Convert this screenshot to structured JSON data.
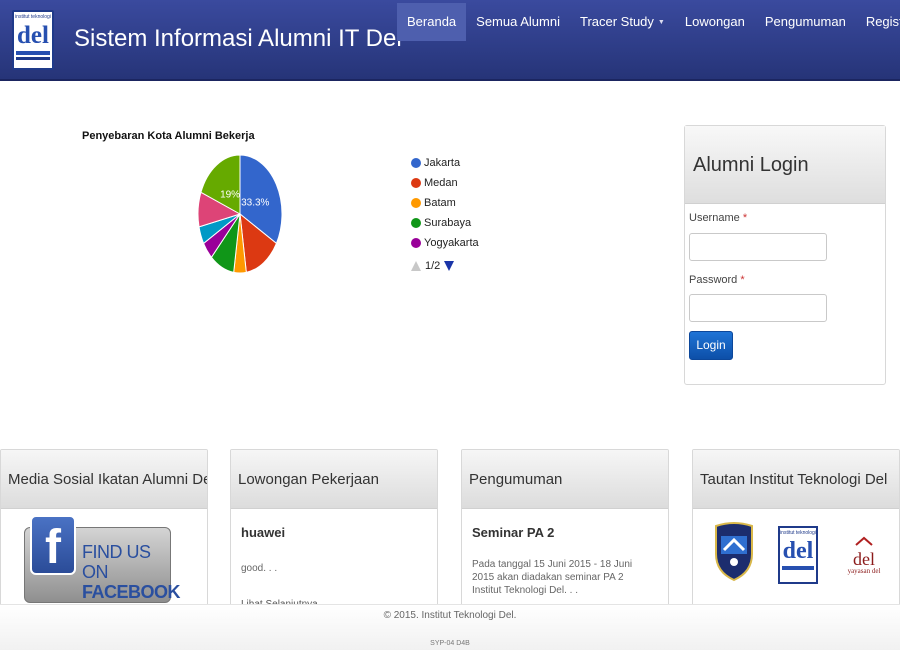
{
  "header": {
    "logo_caption": "institut teknologi",
    "logo_word": "del",
    "title": "Sistem Informasi Alumni IT Del",
    "nav": [
      {
        "label": "Beranda",
        "active": true
      },
      {
        "label": "Semua Alumni"
      },
      {
        "label": "Tracer Study",
        "dropdown": true
      },
      {
        "label": "Lowongan"
      },
      {
        "label": "Pengumuman"
      },
      {
        "label": "Registrasi"
      }
    ]
  },
  "chart_data": {
    "type": "pie",
    "title": "Penyebaran Kota Alumni Bekerja",
    "slices": [
      {
        "label": "Jakarta",
        "value": 33.3,
        "color": "#3366cc",
        "shown_label": "33.3%"
      },
      {
        "label": "Medan",
        "value": 14.3,
        "color": "#dc3912"
      },
      {
        "label": "Batam",
        "value": 4.8,
        "color": "#ff9900"
      },
      {
        "label": "Surabaya",
        "value": 9.5,
        "color": "#109618"
      },
      {
        "label": "Yogyakarta",
        "value": 4.8,
        "color": "#990099"
      },
      {
        "label": "",
        "value": 4.8,
        "color": "#0099c6"
      },
      {
        "label": "",
        "value": 9.5,
        "color": "#dd4477"
      },
      {
        "label": "",
        "value": 19.0,
        "color": "#66aa00",
        "shown_label": "19%"
      }
    ],
    "legend_visible": [
      "Jakarta",
      "Medan",
      "Batam",
      "Surabaya",
      "Yogyakarta"
    ],
    "legend_page": "1/2",
    "legend_position": "right"
  },
  "login": {
    "heading": "Alumni Login",
    "username_label": "Username",
    "password_label": "Password",
    "required_mark": "*",
    "button": "Login"
  },
  "panels": {
    "social": {
      "title": "Media Sosial Ikatan Alumni Del",
      "fb_line1": "FIND US ON",
      "fb_line2": "FACEBOOK",
      "fb_glyph": "f"
    },
    "jobs": {
      "title": "Lowongan Pekerjaan",
      "item_title": "huawei",
      "item_text": "good. . .",
      "more": "Lihat Selanjutnya"
    },
    "news": {
      "title": "Pengumuman",
      "item_title": "Seminar PA 2",
      "item_text": "Pada tanggal 15 Juni 2015 - 18 Juni 2015 akan diadakan seminar PA 2 Institut Teknologi Del. . ."
    },
    "links": {
      "title": "Tautan Institut Teknologi Del",
      "logo3_word": "del",
      "logo3_caption": "yayasan del"
    }
  },
  "footer": {
    "copyright": "© 2015. Institut Teknologi Del.",
    "code": "SYP-04 D4B"
  }
}
